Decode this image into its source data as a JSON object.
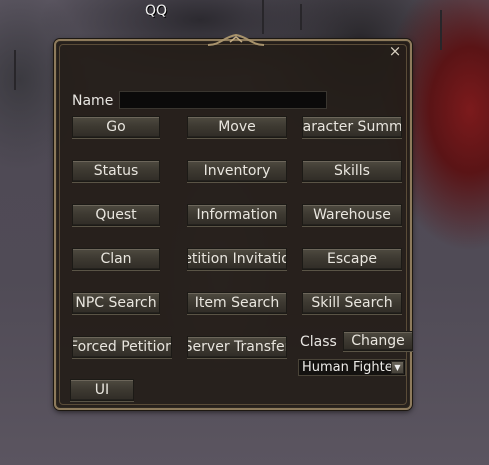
{
  "player": {
    "name": "QQ"
  },
  "window": {
    "close_label": "×",
    "name_label": "Name",
    "name_value": "",
    "buttons": {
      "go": "Go",
      "move": "Move",
      "character_summon": "Character Summon",
      "status": "Status",
      "inventory": "Inventory",
      "skills": "Skills",
      "quest": "Quest",
      "information": "Information",
      "warehouse": "Warehouse",
      "clan": "Clan",
      "petition_invitation": "Petition Invitation",
      "escape": "Escape",
      "npc_search": "NPC Search",
      "item_search": "Item Search",
      "skill_search": "Skill Search",
      "forced_petition": "Forced Petition",
      "server_transfer": "Server Transfer",
      "ui": "UI"
    },
    "class_label": "Class",
    "change_label": "Change",
    "class_selected": "Human Fighter"
  },
  "colors": {
    "window_bg": "#221c16",
    "window_border": "#8e7b5c",
    "button_text": "#e9e6df"
  }
}
